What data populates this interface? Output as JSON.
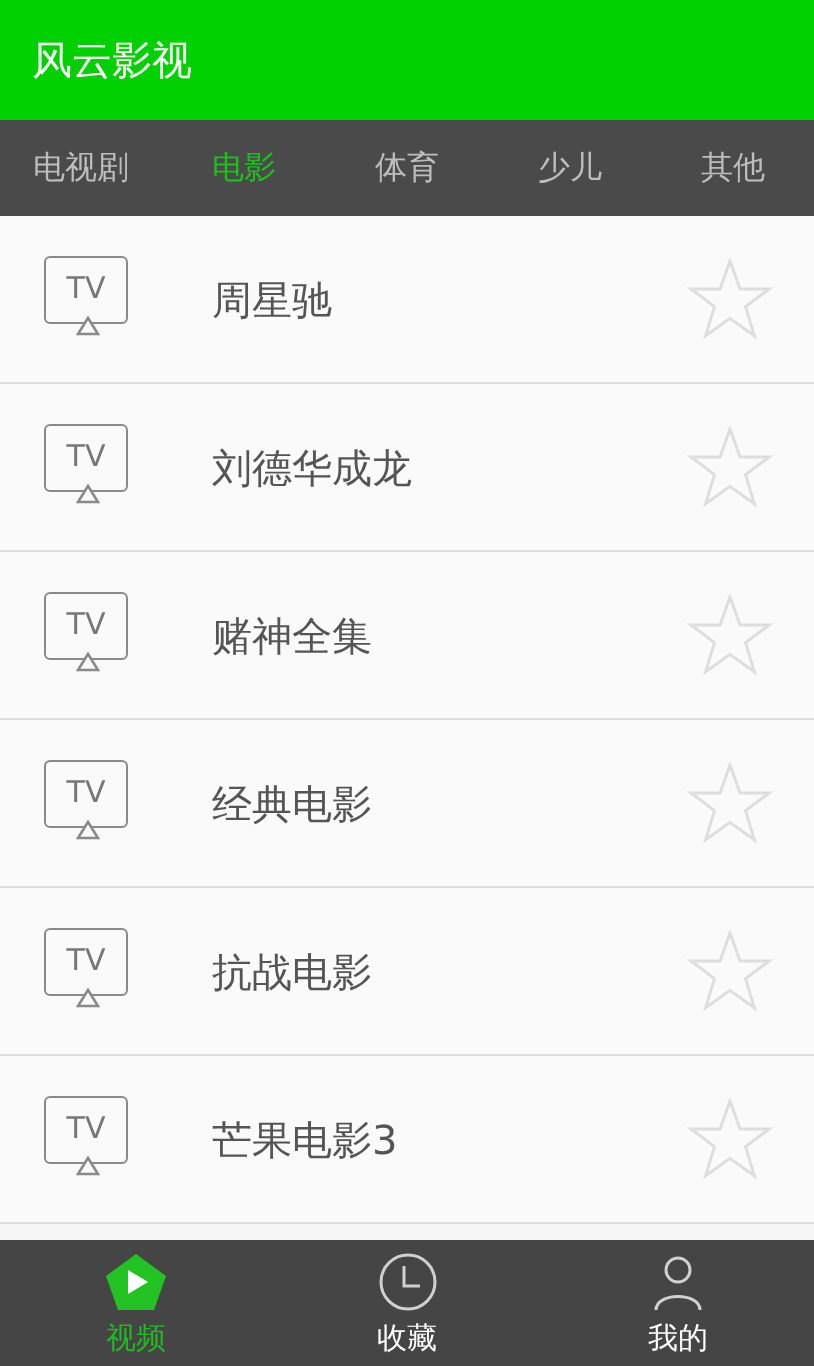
{
  "app_bar": {
    "title": "风云影视"
  },
  "tabs": [
    {
      "label": "电视剧",
      "selected": false
    },
    {
      "label": "电影",
      "selected": true
    },
    {
      "label": "体育",
      "selected": false
    },
    {
      "label": "少儿",
      "selected": false
    },
    {
      "label": "其他",
      "selected": false
    }
  ],
  "items": [
    {
      "icon_label": "TV",
      "title": "周星驰",
      "favorite": false
    },
    {
      "icon_label": "TV",
      "title": "刘德华成龙",
      "favorite": false
    },
    {
      "icon_label": "TV",
      "title": "赌神全集",
      "favorite": false
    },
    {
      "icon_label": "TV",
      "title": "经典电影",
      "favorite": false
    },
    {
      "icon_label": "TV",
      "title": "抗战电影",
      "favorite": false
    },
    {
      "icon_label": "TV",
      "title": "芒果电影3",
      "favorite": false
    }
  ],
  "bottom_nav": [
    {
      "kind": "play",
      "label": "视频",
      "selected": true
    },
    {
      "kind": "clock",
      "label": "收藏",
      "selected": false
    },
    {
      "kind": "person",
      "label": "我的",
      "selected": false
    }
  ]
}
